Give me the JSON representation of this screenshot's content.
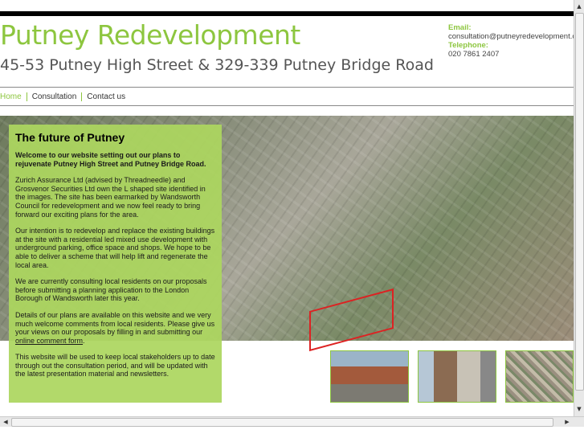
{
  "header": {
    "title": "Putney Redevelopment",
    "subtitle": "45-53 Putney High Street & 329-339 Putney Bridge Road"
  },
  "contact": {
    "email_label": "Email:",
    "email": "consultation@putneyredevelopment.co",
    "phone_label": "Telephone:",
    "phone": "020 7861 2407"
  },
  "nav": [
    {
      "label": "Home"
    },
    {
      "label": "Consultation"
    },
    {
      "label": "Contact us"
    }
  ],
  "panel": {
    "heading": "The future of Putney",
    "intro": "Welcome to our website setting out our plans to rejuvenate Putney High Street and Putney Bridge Road.",
    "p1": "Zurich Assurance Ltd (advised by Threadneedle) and Grosvenor Securities Ltd own the L shaped site identified in the images. The site has been earmarked by Wandsworth Council for redevelopment and we now feel ready to bring forward our exciting plans for the area.",
    "p2": "Our intention is to redevelop and replace the existing buildings at the site with a residential led mixed use development with underground parking, office space and shops. We hope to be able to deliver a scheme that will help lift and regenerate the local area.",
    "p3": "We are currently consulting local residents on our proposals before submitting a planning application to the London Borough of Wandsworth later this year.",
    "p4_before": "Details of our plans are available on this website and we very much welcome comments from local residents. Please give us your views on our proposals by filling in and submitting our ",
    "p4_link": "online comment form",
    "p4_after": ".",
    "p5": "This website will be used to keep local stakeholders up to date through out the consultation period, and will be updated with the latest presentation material and newsletters."
  },
  "scroll": {
    "left_arrow": "◀",
    "right_arrow": "▶",
    "up_arrow": "▲",
    "down_arrow": "▼"
  }
}
